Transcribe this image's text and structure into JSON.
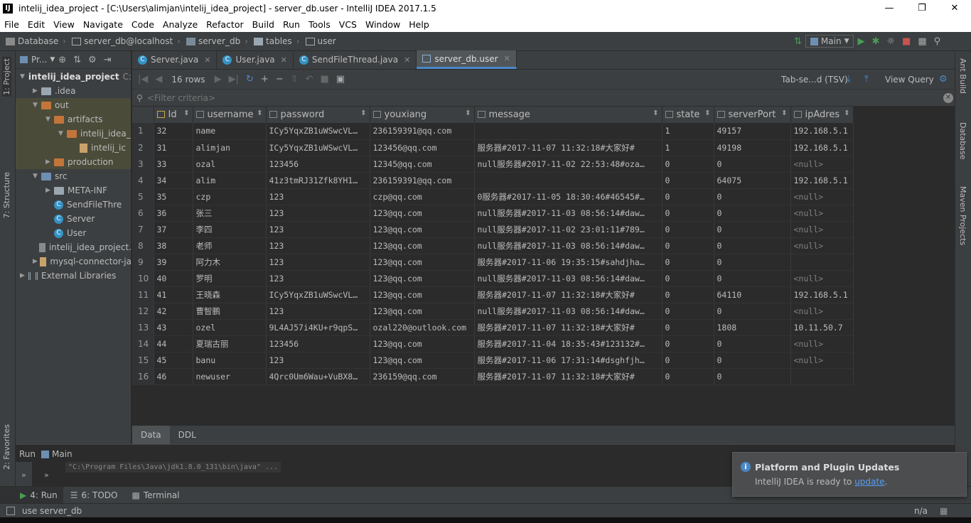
{
  "window": {
    "title": "intelij_idea_project - [C:\\Users\\alimjan\\intelij_idea_project] - server_db.user - IntelliJ IDEA 2017.1.5",
    "logo": "IJ"
  },
  "menu": [
    "File",
    "Edit",
    "View",
    "Navigate",
    "Code",
    "Analyze",
    "Refactor",
    "Build",
    "Run",
    "Tools",
    "VCS",
    "Window",
    "Help"
  ],
  "breadcrumb": [
    "Database",
    "server_db@localhost",
    "server_db",
    "tables",
    "user"
  ],
  "run_config": "Main",
  "left_tabs": {
    "project": "1: Project",
    "structure": "7: Structure",
    "favorites": "2: Favorites"
  },
  "right_tabs": {
    "ant": "Ant Build",
    "database": "Database",
    "maven": "Maven Projects"
  },
  "project_panel": {
    "header": "Pr...",
    "tree": [
      {
        "label": "intelij_idea_project",
        "suffix": "C:",
        "type": "folder-blue",
        "arrow": "▼"
      },
      {
        "label": ".idea",
        "type": "folder",
        "arrow": "▶"
      },
      {
        "label": "out",
        "type": "folder-orange",
        "arrow": "▼"
      },
      {
        "label": "artifacts",
        "type": "folder-orange",
        "arrow": "▼"
      },
      {
        "label": "intelij_idea_",
        "type": "folder-orange",
        "arrow": "▼"
      },
      {
        "label": "intelij_ic",
        "type": "jar",
        "arrow": ""
      },
      {
        "label": "production",
        "type": "folder-orange",
        "arrow": "▶"
      },
      {
        "label": "src",
        "type": "folder-blue",
        "arrow": "▼"
      },
      {
        "label": "META-INF",
        "type": "folder",
        "arrow": "▶"
      },
      {
        "label": "SendFileThre",
        "type": "class",
        "arrow": ""
      },
      {
        "label": "Server",
        "type": "class",
        "arrow": ""
      },
      {
        "label": "User",
        "type": "class",
        "arrow": ""
      },
      {
        "label": "intelij_idea_project.",
        "type": "file",
        "arrow": ""
      },
      {
        "label": "mysql-connector-ja",
        "type": "jar",
        "arrow": "▶"
      },
      {
        "label": "External Libraries",
        "type": "lib",
        "arrow": "▶"
      }
    ]
  },
  "editor_tabs": [
    {
      "label": "Server.java",
      "active": false
    },
    {
      "label": "User.java",
      "active": false
    },
    {
      "label": "SendFileThread.java",
      "active": false
    },
    {
      "label": "server_db.user",
      "active": true
    }
  ],
  "db_toolbar": {
    "rows": "16 rows",
    "export_format": "Tab-se...d (TSV)",
    "view_query": "View Query"
  },
  "filter": {
    "placeholder": "<Filter criteria>"
  },
  "columns": [
    "Id",
    "username",
    "password",
    "youxiang",
    "message",
    "state",
    "serverPort",
    "ipAdres"
  ],
  "rows": [
    [
      "1",
      "32",
      "name",
      "ICy5YqxZB1uWSwcVL…",
      "236159391@qq.com",
      "",
      "1",
      "49157",
      "192.168.5.1"
    ],
    [
      "2",
      "31",
      "alimjan",
      "ICy5YqxZB1uWSwcVL…",
      "123456@qq.com",
      "服务器#2017-11-07 11:32:18#大家好#",
      "1",
      "49198",
      "192.168.5.1"
    ],
    [
      "3",
      "33",
      "ozal",
      "123456",
      "12345@qq.com",
      "null服务器#2017-11-02 22:53:48#oza…",
      "0",
      "0",
      "<null>"
    ],
    [
      "4",
      "34",
      "alim",
      "41z3tmRJ31Zfk8YH1…",
      "236159391@qq.com",
      "",
      "0",
      "64075",
      "192.168.5.1"
    ],
    [
      "5",
      "35",
      "czp",
      "123",
      "czp@qq.com",
      "0服务器#2017-11-05 18:30:46#46545#…",
      "0",
      "0",
      "<null>"
    ],
    [
      "6",
      "36",
      "张三",
      "123",
      "123@qq.com",
      "null服务器#2017-11-03 08:56:14#daw…",
      "0",
      "0",
      "<null>"
    ],
    [
      "7",
      "37",
      "李四",
      "123",
      "123@qq.com",
      "null服务器#2017-11-02 23:01:11#789…",
      "0",
      "0",
      "<null>"
    ],
    [
      "8",
      "38",
      "老师",
      "123",
      "123@qq.com",
      "null服务器#2017-11-03 08:56:14#daw…",
      "0",
      "0",
      "<null>"
    ],
    [
      "9",
      "39",
      "阿力木",
      "123",
      "123@qq.com",
      "服务器#2017-11-06 19:35:15#sahdjha…",
      "0",
      "0",
      ""
    ],
    [
      "10",
      "40",
      "罗明",
      "123",
      "123@qq.com",
      "null服务器#2017-11-03 08:56:14#daw…",
      "0",
      "0",
      "<null>"
    ],
    [
      "11",
      "41",
      "王晓森",
      "ICy5YqxZB1uWSwcVL…",
      "123@qq.com",
      "服务器#2017-11-07 11:32:18#大家好#",
      "0",
      "64110",
      "192.168.5.1"
    ],
    [
      "12",
      "42",
      "曹智鹏",
      "123",
      "123@qq.com",
      "null服务器#2017-11-03 08:56:14#daw…",
      "0",
      "0",
      "<null>"
    ],
    [
      "13",
      "43",
      "ozel",
      "9L4AJ57i4KU+r9qpS…",
      "ozal220@outlook.com",
      "服务器#2017-11-07 11:32:18#大家好#",
      "0",
      "1808",
      "10.11.50.7"
    ],
    [
      "14",
      "44",
      "夏瑞古丽",
      "123456",
      "123@qq.com",
      "服务器#2017-11-04 18:35:43#123132#…",
      "0",
      "0",
      "<null>"
    ],
    [
      "15",
      "45",
      "banu",
      "123",
      "123@qq.com",
      "服务器#2017-11-06 17:31:14#dsghfjh…",
      "0",
      "0",
      "<null>"
    ],
    [
      "16",
      "46",
      "newuser",
      "4Qrc0Um6Wau+VuBX8…",
      "236159@qq.com",
      "服务器#2017-11-07 11:32:18#大家好#",
      "0",
      "0",
      ""
    ]
  ],
  "bottom_tabs": [
    "Data",
    "DDL"
  ],
  "run_panel": {
    "title_run": "Run",
    "title_main": "Main",
    "command": "\"C:\\Program Files\\Java\\jdk1.8.0_131\\bin\\java\" ..."
  },
  "tool_tabs": [
    "4: Run",
    "6: TODO",
    "Terminal"
  ],
  "status": {
    "message": "use server_db",
    "position": "n/a"
  },
  "notification": {
    "title": "Platform and Plugin Updates",
    "text": "IntelliJ IDEA is ready to ",
    "link": "update",
    "suffix": "."
  },
  "colors": {
    "accent": "#4a88c7",
    "null_text": "#808080",
    "link": "#589df6"
  }
}
